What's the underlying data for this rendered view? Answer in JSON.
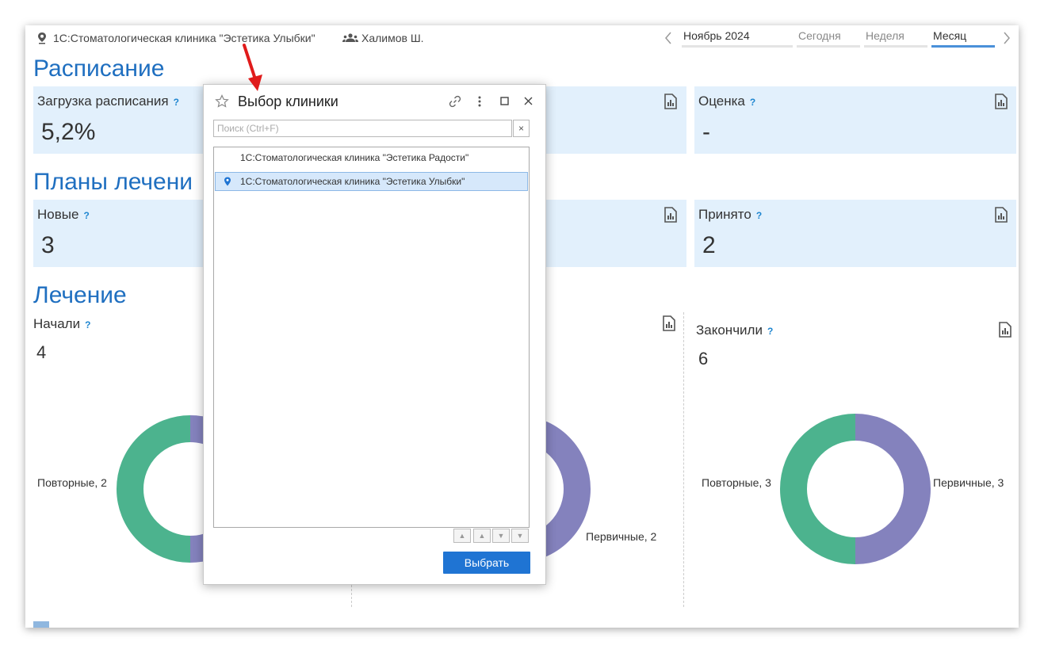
{
  "header": {
    "clinic_name": "1С:Стоматологическая клиника \"Эстетика Улыбки\"",
    "user_name": "Халимов Ш.",
    "period": "Ноябрь 2024",
    "tabs": [
      "Сегодня",
      "Неделя",
      "Месяц"
    ],
    "active_tab": "Месяц"
  },
  "sections": {
    "schedule_title": "Расписание",
    "plans_title": "Планы лечени",
    "treatment_title": "Лечение"
  },
  "cards": {
    "schedule_load": {
      "label": "Загрузка расписания",
      "help": "?",
      "value": "5,2%"
    },
    "rating": {
      "label": "Оценка",
      "help": "?",
      "value": "-"
    },
    "new_plans": {
      "label": "Новые",
      "help": "?",
      "value": "3"
    },
    "accepted": {
      "label": "Принято",
      "help": "?",
      "value": "2"
    }
  },
  "treatment": {
    "started": {
      "label": "Начали",
      "help": "?",
      "value": "4"
    },
    "finished": {
      "label": "Закончили",
      "help": "?",
      "value": "6"
    }
  },
  "chart_data": [
    {
      "type": "pie",
      "categories": [
        "Повторные",
        "Первичные"
      ],
      "values": [
        2,
        2
      ],
      "labels": [
        "Повторные, 2"
      ],
      "colors": [
        "#4cb38e",
        "#8482bd"
      ]
    },
    {
      "type": "pie",
      "categories": [
        "Первичные"
      ],
      "values": [
        2
      ],
      "labels": [
        "Первичные, 2"
      ],
      "colors": [
        "#8482bd"
      ]
    },
    {
      "type": "pie",
      "categories": [
        "Повторные",
        "Первичные"
      ],
      "values": [
        3,
        3
      ],
      "labels": [
        "Повторные, 3",
        "Первичные, 3"
      ],
      "colors": [
        "#4cb38e",
        "#8482bd"
      ]
    }
  ],
  "dialog": {
    "title": "Выбор клиники",
    "search_placeholder": "Поиск (Ctrl+F)",
    "clear_label": "×",
    "items": [
      {
        "label": "1С:Стоматологическая клиника \"Эстетика Радости\"",
        "selected": false
      },
      {
        "label": "1С:Стоматологическая клиника \"Эстетика Улыбки\"",
        "selected": true
      }
    ],
    "select_button": "Выбрать"
  },
  "colors": {
    "accent": "#1f6fc0",
    "card_bg": "#e2f0fc",
    "button": "#1f74d3",
    "annotation_arrow": "#e01b1b"
  }
}
